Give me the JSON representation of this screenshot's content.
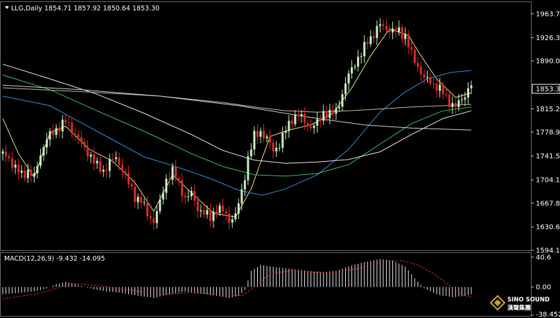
{
  "chart_data": {
    "type": "candlestick",
    "symbol_label": "LLG,Daily",
    "ohlc_header": "1854.71 1857.92 1850.64 1853.30",
    "price_axis": {
      "range": [
        1594.1,
        1982.0
      ],
      "ticks": [
        "1963.70",
        "1926.30",
        "1890.00",
        "1815.20",
        "1778.90",
        "1741.50",
        "1704.10",
        "1667.80",
        "1630.60",
        "1594.10"
      ],
      "last_price": "1853.30"
    },
    "close_path": [
      [
        0,
        1745
      ],
      [
        4,
        1738
      ],
      [
        8,
        1722
      ],
      [
        12,
        1712
      ],
      [
        16,
        1718
      ],
      [
        20,
        1708
      ],
      [
        24,
        1745
      ],
      [
        28,
        1768
      ],
      [
        32,
        1778
      ],
      [
        36,
        1788
      ],
      [
        40,
        1795
      ],
      [
        44,
        1782
      ],
      [
        48,
        1770
      ],
      [
        52,
        1752
      ],
      [
        56,
        1742
      ],
      [
        60,
        1725
      ],
      [
        64,
        1718
      ],
      [
        68,
        1732
      ],
      [
        72,
        1738
      ],
      [
        76,
        1722
      ],
      [
        80,
        1698
      ],
      [
        84,
        1678
      ],
      [
        88,
        1672
      ],
      [
        92,
        1650
      ],
      [
        96,
        1640
      ],
      [
        100,
        1668
      ],
      [
        104,
        1705
      ],
      [
        108,
        1718
      ],
      [
        112,
        1698
      ],
      [
        116,
        1676
      ],
      [
        120,
        1682
      ],
      [
        124,
        1660
      ],
      [
        128,
        1652
      ],
      [
        132,
        1645
      ],
      [
        136,
        1660
      ],
      [
        140,
        1655
      ],
      [
        144,
        1642
      ],
      [
        148,
        1648
      ],
      [
        152,
        1685
      ],
      [
        156,
        1738
      ],
      [
        160,
        1772
      ],
      [
        164,
        1780
      ],
      [
        168,
        1768
      ],
      [
        172,
        1750
      ],
      [
        176,
        1760
      ],
      [
        180,
        1782
      ],
      [
        184,
        1800
      ],
      [
        188,
        1806
      ],
      [
        192,
        1795
      ],
      [
        196,
        1786
      ],
      [
        200,
        1792
      ],
      [
        204,
        1810
      ],
      [
        208,
        1806
      ],
      [
        212,
        1812
      ],
      [
        216,
        1838
      ],
      [
        220,
        1868
      ],
      [
        224,
        1888
      ],
      [
        228,
        1900
      ],
      [
        232,
        1922
      ],
      [
        236,
        1932
      ],
      [
        240,
        1946
      ],
      [
        244,
        1942
      ],
      [
        248,
        1935
      ],
      [
        252,
        1938
      ],
      [
        256,
        1928
      ],
      [
        260,
        1900
      ],
      [
        264,
        1882
      ],
      [
        268,
        1862
      ],
      [
        272,
        1858
      ],
      [
        276,
        1850
      ],
      [
        280,
        1840
      ],
      [
        284,
        1826
      ],
      [
        288,
        1818
      ],
      [
        292,
        1830
      ],
      [
        296,
        1846
      ],
      [
        298,
        1853
      ]
    ],
    "moving_averages": [
      {
        "color": "#e8e08a",
        "path": [
          [
            0,
            1800
          ],
          [
            10,
            1745
          ],
          [
            20,
            1708
          ],
          [
            30,
            1778
          ],
          [
            40,
            1788
          ],
          [
            55,
            1752
          ],
          [
            70,
            1733
          ],
          [
            84,
            1700
          ],
          [
            96,
            1655
          ],
          [
            108,
            1712
          ],
          [
            120,
            1684
          ],
          [
            134,
            1652
          ],
          [
            148,
            1646
          ],
          [
            158,
            1690
          ],
          [
            170,
            1772
          ],
          [
            182,
            1782
          ],
          [
            196,
            1790
          ],
          [
            210,
            1808
          ],
          [
            222,
            1848
          ],
          [
            234,
            1898
          ],
          [
            246,
            1940
          ],
          [
            258,
            1930
          ],
          [
            266,
            1898
          ],
          [
            276,
            1862
          ],
          [
            288,
            1833
          ],
          [
            298,
            1840
          ]
        ]
      },
      {
        "color": "#2f8fe0",
        "path": [
          [
            0,
            1835
          ],
          [
            30,
            1820
          ],
          [
            60,
            1780
          ],
          [
            90,
            1740
          ],
          [
            110,
            1725
          ],
          [
            130,
            1708
          ],
          [
            150,
            1688
          ],
          [
            165,
            1680
          ],
          [
            180,
            1690
          ],
          [
            200,
            1712
          ],
          [
            220,
            1752
          ],
          [
            240,
            1810
          ],
          [
            255,
            1840
          ],
          [
            270,
            1862
          ],
          [
            285,
            1872
          ],
          [
            298,
            1875
          ]
        ]
      },
      {
        "color": "#3cc060",
        "path": [
          [
            0,
            1868
          ],
          [
            30,
            1845
          ],
          [
            60,
            1812
          ],
          [
            90,
            1780
          ],
          [
            120,
            1745
          ],
          [
            140,
            1725
          ],
          [
            160,
            1712
          ],
          [
            180,
            1710
          ],
          [
            200,
            1714
          ],
          [
            220,
            1728
          ],
          [
            240,
            1760
          ],
          [
            260,
            1792
          ],
          [
            280,
            1812
          ],
          [
            298,
            1818
          ]
        ]
      },
      {
        "color": "#e8e8e8",
        "path": [
          [
            0,
            1885
          ],
          [
            30,
            1862
          ],
          [
            60,
            1838
          ],
          [
            90,
            1808
          ],
          [
            120,
            1775
          ],
          [
            140,
            1750
          ],
          [
            160,
            1735
          ],
          [
            180,
            1730
          ],
          [
            200,
            1732
          ],
          [
            220,
            1736
          ],
          [
            240,
            1748
          ],
          [
            260,
            1775
          ],
          [
            280,
            1800
          ],
          [
            298,
            1812
          ]
        ]
      },
      {
        "color": "#c8b89a",
        "path": [
          [
            0,
            1848
          ],
          [
            50,
            1842
          ],
          [
            100,
            1835
          ],
          [
            140,
            1825
          ],
          [
            160,
            1818
          ],
          [
            180,
            1812
          ],
          [
            200,
            1810
          ],
          [
            220,
            1812
          ],
          [
            240,
            1815
          ],
          [
            260,
            1818
          ],
          [
            280,
            1820
          ],
          [
            298,
            1822
          ]
        ]
      },
      {
        "color": "#d0d0d0",
        "path": [
          [
            0,
            1852
          ],
          [
            50,
            1845
          ],
          [
            100,
            1835
          ],
          [
            150,
            1820
          ],
          [
            200,
            1800
          ],
          [
            230,
            1790
          ],
          [
            260,
            1785
          ],
          [
            298,
            1782
          ]
        ]
      }
    ],
    "macd": {
      "label": "MACD(12,26,9) -9.432 -14.095",
      "ticks": [
        "40.6",
        "0.00",
        "-38.452"
      ],
      "range": [
        -38.452,
        40.6
      ],
      "histogram_path": [
        [
          0,
          -10
        ],
        [
          10,
          -8
        ],
        [
          20,
          -6
        ],
        [
          28,
          -2
        ],
        [
          34,
          4
        ],
        [
          40,
          7
        ],
        [
          46,
          4
        ],
        [
          52,
          0
        ],
        [
          58,
          -3
        ],
        [
          66,
          -6
        ],
        [
          76,
          -8
        ],
        [
          86,
          -12
        ],
        [
          96,
          -15
        ],
        [
          106,
          -10
        ],
        [
          116,
          -6
        ],
        [
          126,
          -9
        ],
        [
          136,
          -12
        ],
        [
          144,
          -15
        ],
        [
          150,
          -12
        ],
        [
          154,
          -4
        ],
        [
          158,
          22
        ],
        [
          164,
          30
        ],
        [
          170,
          28
        ],
        [
          178,
          26
        ],
        [
          186,
          24
        ],
        [
          194,
          22
        ],
        [
          204,
          20
        ],
        [
          212,
          22
        ],
        [
          220,
          28
        ],
        [
          230,
          34
        ],
        [
          240,
          38
        ],
        [
          248,
          36
        ],
        [
          256,
          28
        ],
        [
          262,
          12
        ],
        [
          268,
          -2
        ],
        [
          276,
          -10
        ],
        [
          286,
          -14
        ],
        [
          294,
          -12
        ],
        [
          298,
          -10
        ]
      ],
      "signal_path": [
        [
          0,
          -16
        ],
        [
          20,
          -10
        ],
        [
          34,
          -2
        ],
        [
          44,
          5
        ],
        [
          60,
          2
        ],
        [
          80,
          -4
        ],
        [
          100,
          -10
        ],
        [
          120,
          -8
        ],
        [
          140,
          -10
        ],
        [
          152,
          -12
        ],
        [
          160,
          0
        ],
        [
          170,
          18
        ],
        [
          182,
          22
        ],
        [
          196,
          20
        ],
        [
          212,
          20
        ],
        [
          228,
          26
        ],
        [
          242,
          34
        ],
        [
          254,
          36
        ],
        [
          264,
          30
        ],
        [
          274,
          18
        ],
        [
          284,
          2
        ],
        [
          294,
          -12
        ],
        [
          298,
          -14
        ]
      ]
    }
  },
  "logo": {
    "name": "SINO SOUND",
    "cn": "漢聲集團"
  }
}
